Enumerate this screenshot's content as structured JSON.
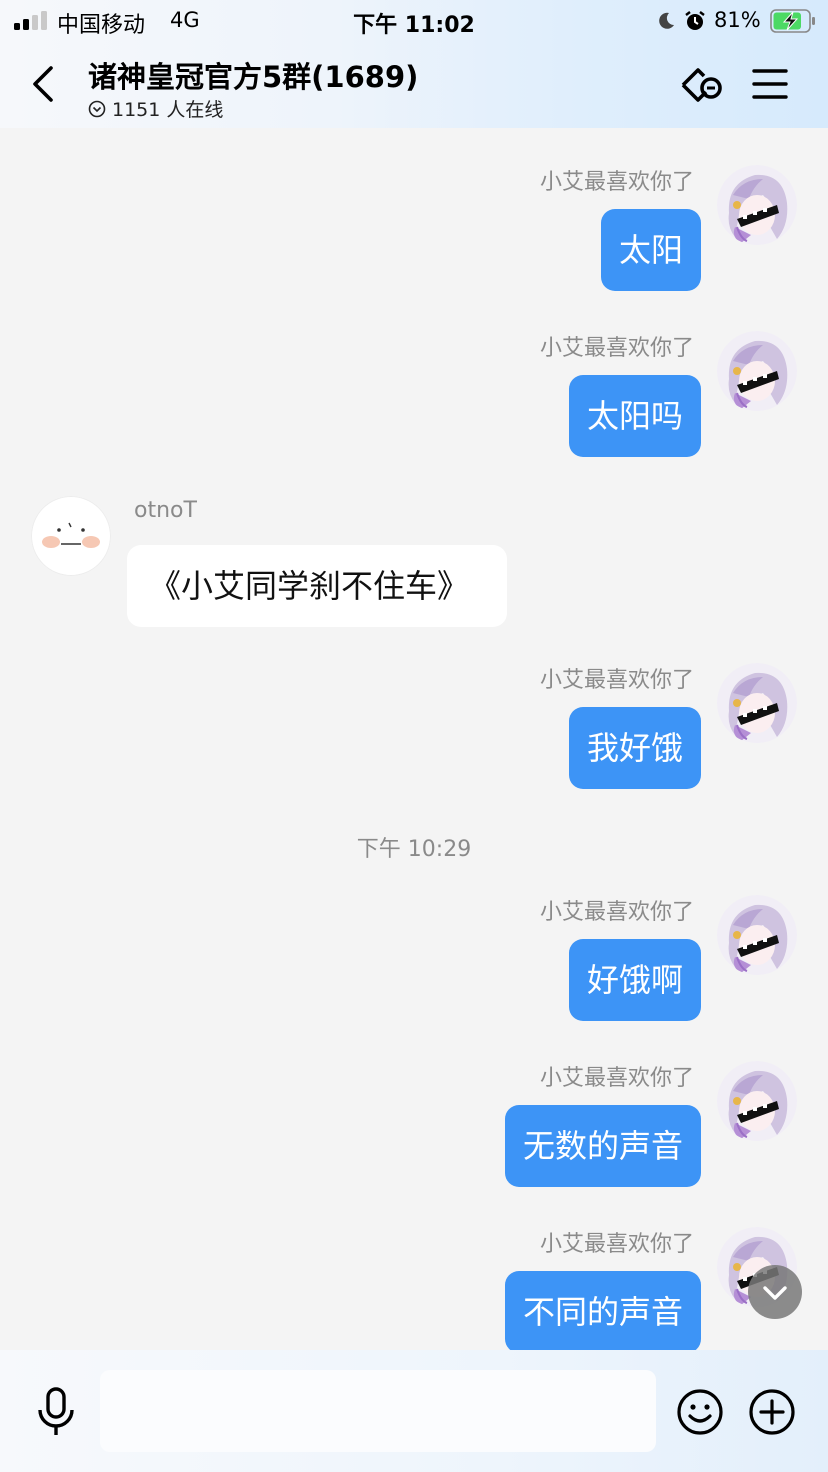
{
  "status_bar": {
    "carrier": "中国移动",
    "network": "4G",
    "time": "下午 11:02",
    "battery_percent": "81%",
    "battery_level": 0.81,
    "icons": [
      "signal-icon",
      "moon-icon",
      "alarm-icon",
      "battery-charging-icon"
    ]
  },
  "header": {
    "title": "诸神皇冠官方5群(1689)",
    "online_count": "1151 人在线",
    "icons": [
      "back-arrow-icon",
      "group-link-icon",
      "menu-icon",
      "online-status-icon"
    ]
  },
  "chat": {
    "messages": [
      {
        "sender": "小艾最喜欢你了",
        "text": "太阳",
        "mine": true
      },
      {
        "sender": "小艾最喜欢你了",
        "text": "太阳吗",
        "mine": true
      },
      {
        "sender": "otnoT",
        "text": "《小艾同学刹不住车》",
        "mine": false
      },
      {
        "sender": "小艾最喜欢你了",
        "text": "我好饿",
        "mine": true
      },
      {
        "sender": "小艾最喜欢你了",
        "text": "好饿啊",
        "mine": true
      },
      {
        "sender": "小艾最喜欢你了",
        "text": "无数的声音",
        "mine": true
      },
      {
        "sender": "小艾最喜欢你了",
        "text": "不同的声音",
        "mine": true
      }
    ],
    "time_divider": "下午 10:29"
  },
  "input_bar": {
    "placeholder": "",
    "icons": [
      "microphone-icon",
      "emoji-icon",
      "plus-icon"
    ]
  },
  "colors": {
    "my_bubble": "#3d94f6",
    "their_bubble": "#ffffff",
    "chat_background": "#f4f4f4"
  }
}
